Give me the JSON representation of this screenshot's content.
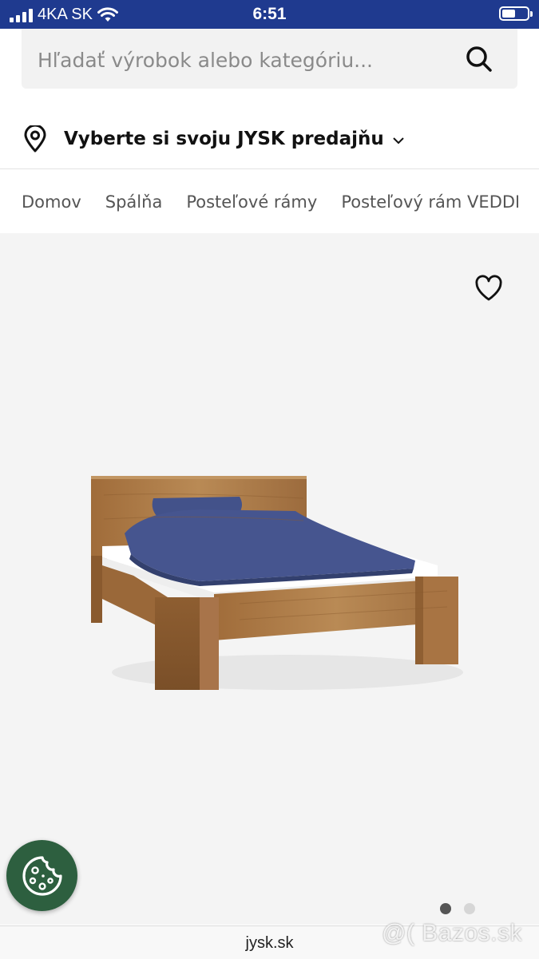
{
  "status_bar": {
    "carrier": "4KA SK",
    "time": "6:51"
  },
  "search": {
    "placeholder": "Hľadať výrobok alebo kategóriu..."
  },
  "store_selector": {
    "label": "Vyberte si svoju JYSK predajňu"
  },
  "breadcrumb": [
    "Domov",
    "Spálňa",
    "Posteľové rámy",
    "Posteľový rám VEDDE"
  ],
  "product": {
    "image": "wooden bed frame with blue bedding",
    "carousel": {
      "total": 2,
      "active": 1
    }
  },
  "icons": {
    "search": "search-icon",
    "location": "map-pin-icon",
    "favorite": "heart-icon",
    "cookie": "cookie-icon"
  },
  "colors": {
    "status_bar": "#1f3a8f",
    "cookie_button": "#2d5f3f"
  },
  "browser": {
    "url": "jysk.sk"
  },
  "watermark": "@( Bazos.sk"
}
